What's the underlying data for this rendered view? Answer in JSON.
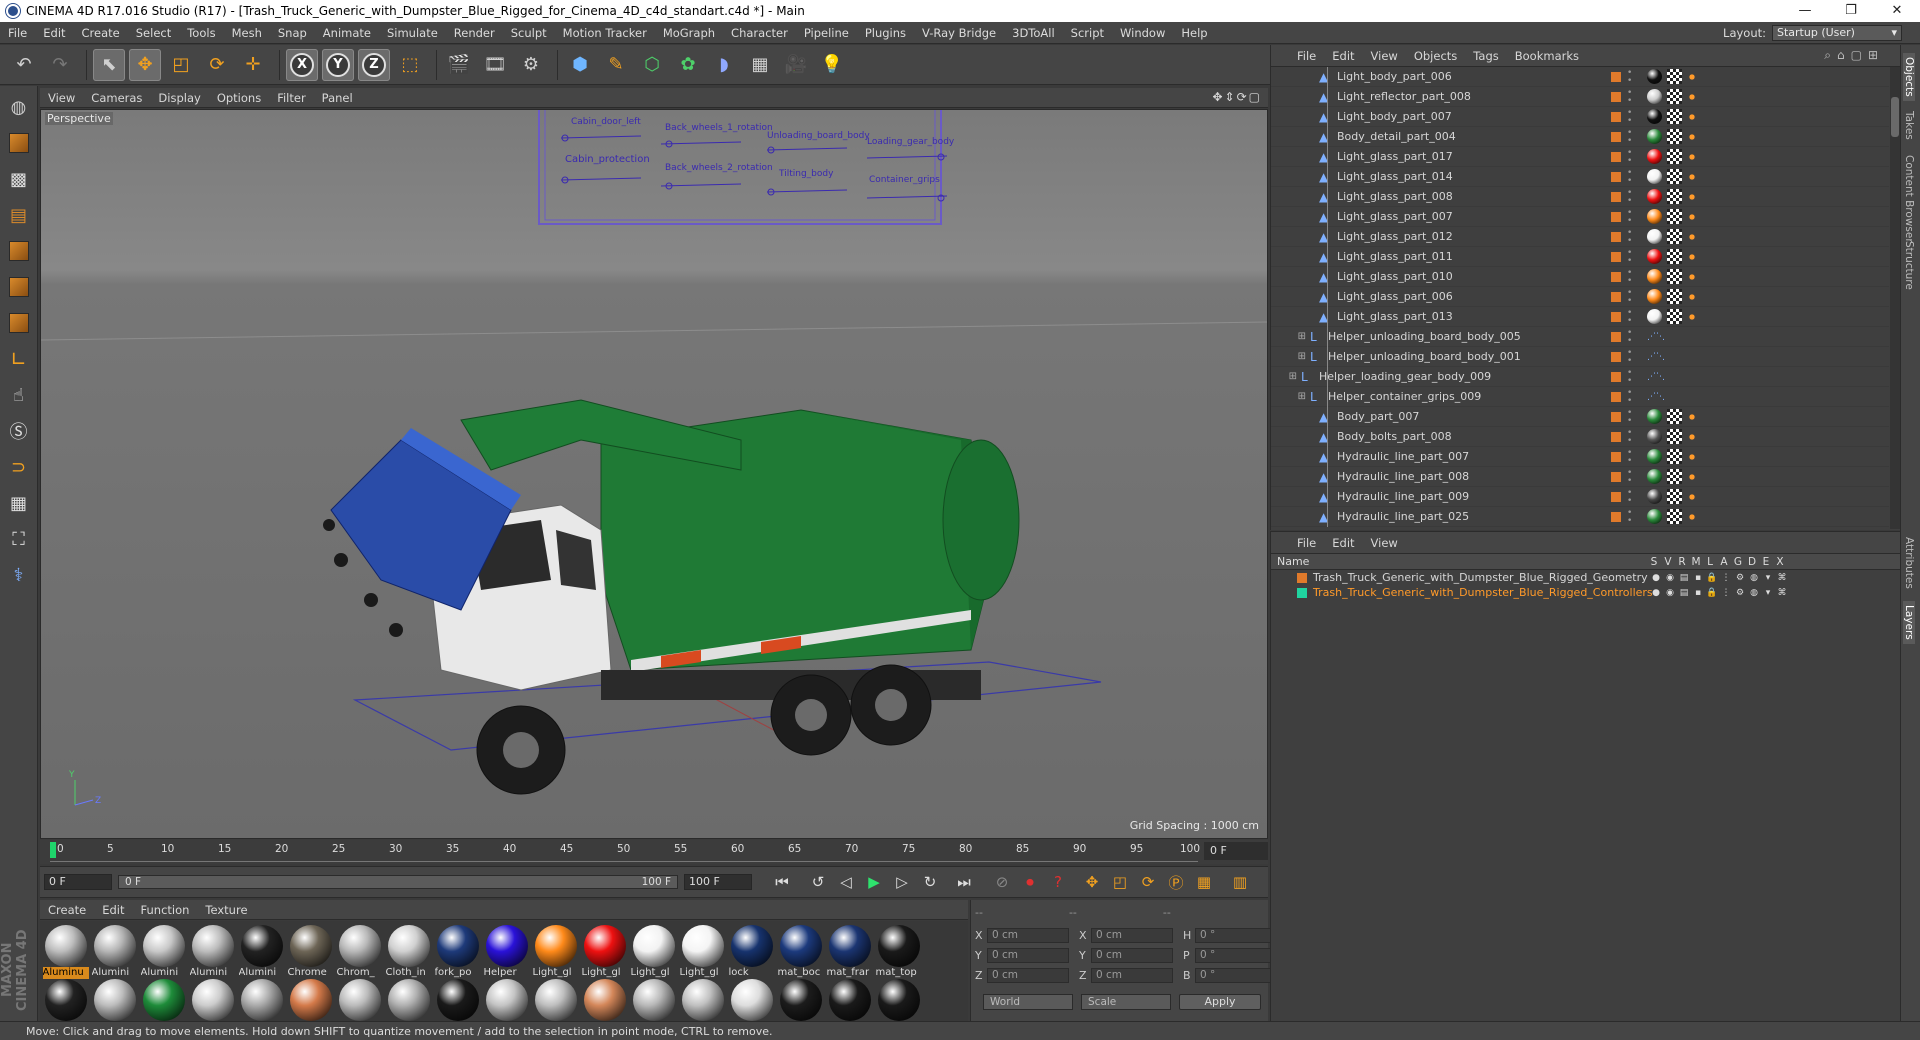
{
  "window": {
    "title": "CINEMA 4D R17.016 Studio (R17) - [Trash_Truck_Generic_with_Dumpster_Blue_Rigged_for_Cinema_4D_c4d_standart.c4d *] - Main",
    "minimize": "—",
    "restore": "❐",
    "close": "✕"
  },
  "menubar": {
    "items": [
      "File",
      "Edit",
      "Create",
      "Select",
      "Tools",
      "Mesh",
      "Snap",
      "Animate",
      "Simulate",
      "Render",
      "Sculpt",
      "Motion Tracker",
      "MoGraph",
      "Character",
      "Pipeline",
      "Plugins",
      "V-Ray Bridge",
      "3DToAll",
      "Script",
      "Window",
      "Help"
    ],
    "layout_label": "Layout:",
    "layout_value": "Startup (User)"
  },
  "toolbar": {
    "axis_x": "X",
    "axis_y": "Y",
    "axis_z": "Z"
  },
  "viewport": {
    "menu": [
      "View",
      "Cameras",
      "Display",
      "Options",
      "Filter",
      "Panel"
    ],
    "label": "Perspective",
    "grid_spacing": "Grid Spacing : 1000 cm",
    "nav_icons": "✥⇕⟳▢",
    "rig_panel_labels": [
      "Cabin_door_left",
      "Back_wheels_1_rotation",
      "Unloading_board_body",
      "Loading_gear_body",
      "Cabin_protection",
      "Back_wheels_2_rotation",
      "Tilting_body",
      "Container_grips"
    ],
    "axis_y": "Y",
    "axis_z": "Z"
  },
  "timeline": {
    "ticks": [
      "0",
      "5",
      "10",
      "15",
      "20",
      "25",
      "30",
      "35",
      "40",
      "45",
      "50",
      "55",
      "60",
      "65",
      "70",
      "75",
      "80",
      "85",
      "90",
      "95",
      "100"
    ],
    "current_frame": "0 F"
  },
  "transport": {
    "start_field": "0 F",
    "range_start": "0 F",
    "range_end": "100 F",
    "end_field": "100 F"
  },
  "materials": {
    "menu": [
      "Create",
      "Edit",
      "Function",
      "Texture"
    ],
    "row1": [
      {
        "name": "Aluminu",
        "color": "#bdbdbd",
        "selected": true
      },
      {
        "name": "Alumini",
        "color": "#b5b5b5"
      },
      {
        "name": "Alumini",
        "color": "#c8c8c8"
      },
      {
        "name": "Alumini",
        "color": "#bcbcbc"
      },
      {
        "name": "Alumini",
        "color": "#222222"
      },
      {
        "name": "Chrome",
        "color": "#6d6556"
      },
      {
        "name": "Chrom_",
        "color": "#b8b8b8"
      },
      {
        "name": "Cloth_in",
        "color": "#d0d0d0"
      },
      {
        "name": "fork_po",
        "color": "#1e3a7a"
      },
      {
        "name": "Helper",
        "color": "#2a12d8"
      },
      {
        "name": "Light_gl",
        "color": "#ff8a1a"
      },
      {
        "name": "Light_gl",
        "color": "#ee1111"
      },
      {
        "name": "Light_gl",
        "color": "#f2f2f2"
      },
      {
        "name": "Light_gl",
        "color": "#f4f4f4"
      },
      {
        "name": "lock",
        "color": "#17336e"
      },
      {
        "name": "mat_boc",
        "color": "#1c3a7d"
      },
      {
        "name": "mat_frar",
        "color": "#1b3572"
      },
      {
        "name": "mat_top",
        "color": "#1a1a1a"
      }
    ],
    "row2": [
      {
        "color": "#222222"
      },
      {
        "color": "#bdbdbd"
      },
      {
        "color": "#1e8c3a"
      },
      {
        "color": "#cccccc"
      },
      {
        "color": "#aaaaaa"
      },
      {
        "color": "#d47a4a"
      },
      {
        "color": "#bbbbbb"
      },
      {
        "color": "#b0b0b0"
      },
      {
        "color": "#1a1a1a"
      },
      {
        "color": "#c4c4c4"
      },
      {
        "color": "#bfbfbf"
      },
      {
        "color": "#d4875a"
      },
      {
        "color": "#b8b8b8"
      },
      {
        "color": "#c0c0c0"
      },
      {
        "color": "#dddddd"
      },
      {
        "color": "#1c1c1c"
      },
      {
        "color": "#1a1a1a"
      },
      {
        "color": "#1a1a1a"
      }
    ]
  },
  "coords": {
    "header": [
      "--",
      "--",
      "--"
    ],
    "rows": [
      {
        "a": "X",
        "v1": "0 cm",
        "b": "X",
        "v2": "0 cm",
        "c": "H",
        "v3": "0 °"
      },
      {
        "a": "Y",
        "v1": "0 cm",
        "b": "Y",
        "v2": "0 cm",
        "c": "P",
        "v3": "0 °"
      },
      {
        "a": "Z",
        "v1": "0 cm",
        "b": "Z",
        "v2": "0 cm",
        "c": "B",
        "v3": "0 °"
      }
    ],
    "mode": "World",
    "scale": "Scale",
    "apply": "Apply"
  },
  "object_manager": {
    "menu": [
      "File",
      "Edit",
      "View",
      "Objects",
      "Tags",
      "Bookmarks"
    ],
    "items": [
      {
        "label": "Light_body_part_006",
        "indent": 2,
        "tag": "#111111"
      },
      {
        "label": "Light_reflector_part_008",
        "indent": 2,
        "tag": "#cccccc"
      },
      {
        "label": "Light_body_part_007",
        "indent": 2,
        "tag": "#111111"
      },
      {
        "label": "Body_detail_part_004",
        "indent": 2,
        "tag": "#2a8a3a"
      },
      {
        "label": "Light_glass_part_017",
        "indent": 2,
        "tag": "#ee1111"
      },
      {
        "label": "Light_glass_part_014",
        "indent": 2,
        "tag": "#f2f2f2"
      },
      {
        "label": "Light_glass_part_008",
        "indent": 2,
        "tag": "#ee1111"
      },
      {
        "label": "Light_glass_part_007",
        "indent": 2,
        "tag": "#ff8a1a"
      },
      {
        "label": "Light_glass_part_012",
        "indent": 2,
        "tag": "#f2f2f2"
      },
      {
        "label": "Light_glass_part_011",
        "indent": 2,
        "tag": "#ee1111"
      },
      {
        "label": "Light_glass_part_010",
        "indent": 2,
        "tag": "#ff8a1a"
      },
      {
        "label": "Light_glass_part_006",
        "indent": 2,
        "tag": "#ff8a1a"
      },
      {
        "label": "Light_glass_part_013",
        "indent": 2,
        "tag": "#f2f2f2"
      },
      {
        "label": "Helper_unloading_board_body_005",
        "indent": 1,
        "tag": ""
      },
      {
        "label": "Helper_unloading_board_body_001",
        "indent": 1,
        "tag": ""
      },
      {
        "label": "Helper_loading_gear_body_009",
        "indent": 0,
        "tag": ""
      },
      {
        "label": "Helper_container_grips_009",
        "indent": 1,
        "tag": ""
      },
      {
        "label": "Body_part_007",
        "indent": 2,
        "tag": "#2a8a3a"
      },
      {
        "label": "Body_bolts_part_008",
        "indent": 2,
        "tag": "#555555"
      },
      {
        "label": "Hydraulic_line_part_007",
        "indent": 2,
        "tag": "#2a8a3a"
      },
      {
        "label": "Hydraulic_line_part_008",
        "indent": 2,
        "tag": "#2a8a3a"
      },
      {
        "label": "Hydraulic_line_part_009",
        "indent": 2,
        "tag": "#444444"
      },
      {
        "label": "Hydraulic_line_part_025",
        "indent": 2,
        "tag": "#2a8a3a"
      }
    ]
  },
  "right_tabs": [
    "Objects",
    "Takes",
    "Content Browser",
    "Structure",
    "Attributes",
    "Layers"
  ],
  "layer_manager": {
    "menu": [
      "File",
      "Edit",
      "View"
    ],
    "header_name": "Name",
    "columns": [
      "S",
      "V",
      "R",
      "M",
      "L",
      "A",
      "G",
      "D",
      "E",
      "X"
    ],
    "layers": [
      {
        "name": "Trash_Truck_Generic_with_Dumpster_Blue_Rigged_Geometry",
        "color": "#e07a2b",
        "text_color": "#d6d6d6"
      },
      {
        "name": "Trash_Truck_Generic_with_Dumpster_Blue_Rigged_Controllers",
        "color": "#20d4a0",
        "text_color": "#ff9a2a"
      }
    ]
  },
  "status": "Move: Click and drag to move elements. Hold down SHIFT to quantize movement / add to the selection in point mode, CTRL to remove.",
  "maxon_text": "MAXON CINEMA 4D"
}
